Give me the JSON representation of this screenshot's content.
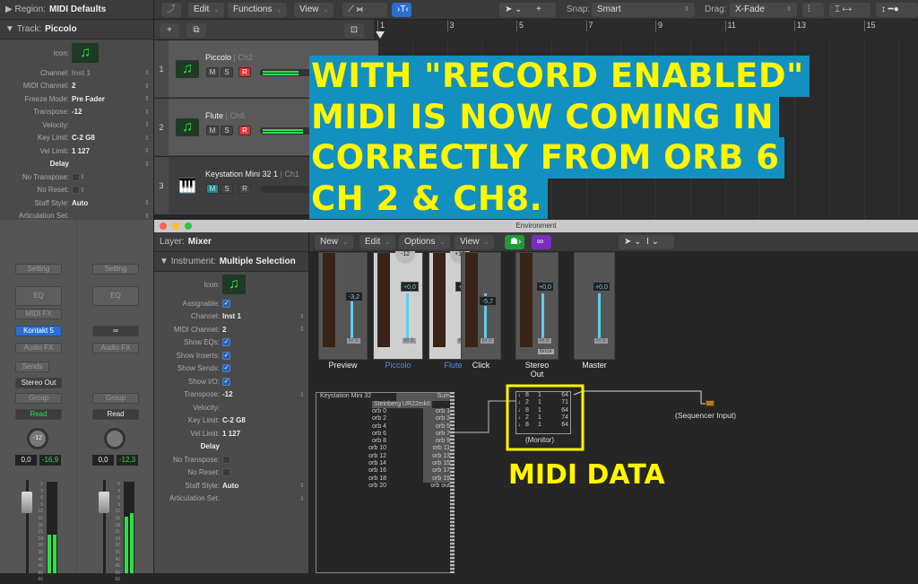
{
  "inspector": {
    "region_label": "Region:",
    "region_value": "MIDI Defaults",
    "track_label": "Track:",
    "track_value": "Piccolo",
    "icon_label": "Icon:",
    "params": [
      {
        "label": "Channel:",
        "value": "Inst 1",
        "dim": true
      },
      {
        "label": "MIDI Channel:",
        "value": "2"
      },
      {
        "label": "Freeze Mode:",
        "value": "Pre Fader"
      },
      {
        "label": "Transpose:",
        "value": "-12"
      },
      {
        "label": "Velocity:",
        "value": ""
      },
      {
        "label": "Key Limit:",
        "value": "C-2  G8"
      },
      {
        "label": "Vel Limit:",
        "value": "1  127"
      },
      {
        "label": "Delay",
        "value": ""
      },
      {
        "label": "No Transpose:",
        "value": ""
      },
      {
        "label": "No Reset:",
        "value": ""
      },
      {
        "label": "Staff Style:",
        "value": "Auto"
      },
      {
        "label": "Articulation Set:",
        "value": ""
      }
    ]
  },
  "strips": [
    {
      "setting": "Setting",
      "eq": "EQ",
      "midi_fx": "MIDI FX",
      "instrument": "Kontakt 5",
      "audio_fx": "Audio FX",
      "sends": "Sends",
      "output": "Stereo Out",
      "group": "Group",
      "automation": "Read",
      "pan": "-12",
      "volume": "0,0",
      "peak": "-16,9",
      "meter_level": 0.42
    },
    {
      "setting": "Setting",
      "eq": "EQ",
      "link": "link",
      "audio_fx": "Audio FX",
      "group": "Group",
      "automation": "Read",
      "pan": "",
      "volume": "0,0",
      "peak": "-12,3",
      "meter_level": 0.62
    }
  ],
  "meter_scale": [
    "0",
    "3",
    "6",
    "9",
    "12",
    "15",
    "18",
    "21",
    "24",
    "30",
    "35",
    "40",
    "45",
    "50",
    "60"
  ],
  "toolbar": {
    "edit": "Edit",
    "functions": "Functions",
    "view": "View",
    "snap_label": "Snap:",
    "snap_value": "Smart",
    "drag_label": "Drag:",
    "drag_value": "X-Fade"
  },
  "ruler": [
    "1",
    "3",
    "5",
    "7",
    "9",
    "11",
    "13",
    "15"
  ],
  "tracks": [
    {
      "num": "1",
      "name": "Piccolo",
      "channel": "Ch2",
      "record": true,
      "icon": "music-note",
      "level": 0.8
    },
    {
      "num": "2",
      "name": "Flute",
      "channel": "Ch8",
      "record": true,
      "icon": "music-note",
      "level": 0.9
    },
    {
      "num": "3",
      "name": "Keystation Mini 32 1",
      "channel": "Ch1",
      "record": false,
      "mute": true,
      "icon": "piano",
      "level": 0
    }
  ],
  "track_buttons": {
    "mute": "M",
    "solo": "S",
    "record": "R"
  },
  "environment": {
    "title": "Environment",
    "layer_label": "Layer:",
    "layer_value": "Mixer",
    "instrument_label": "Instrument:",
    "instrument_value": "Multiple Selection",
    "params": [
      {
        "label": "Icon:",
        "type": "icon"
      },
      {
        "label": "Assignable:",
        "type": "check",
        "on": true
      },
      {
        "label": "Channel:",
        "value": "Inst 1",
        "arrow": true
      },
      {
        "label": "MIDI Channel:",
        "value": "2",
        "arrow": true
      },
      {
        "label": "Show EQs:",
        "type": "check",
        "on": true
      },
      {
        "label": "Show Inserts:",
        "type": "check",
        "on": true
      },
      {
        "label": "Show Sends:",
        "type": "check",
        "on": true
      },
      {
        "label": "Show I/O:",
        "type": "check",
        "on": true
      },
      {
        "label": "Transpose:",
        "value": "-12",
        "arrow": true
      },
      {
        "label": "Velocity:",
        "value": ""
      },
      {
        "label": "Key Limit:",
        "value": "C-2  G8"
      },
      {
        "label": "Vel Limit:",
        "value": "1  127"
      },
      {
        "label": "Delay",
        "value": ""
      },
      {
        "label": "No Transpose:",
        "type": "check",
        "on": false
      },
      {
        "label": "No Reset:",
        "type": "check",
        "on": false
      },
      {
        "label": "Staff Style:",
        "value": "Auto",
        "arrow": true
      },
      {
        "label": "Articulation Set:",
        "value": "",
        "arrow": true
      }
    ],
    "menu": {
      "new": "New",
      "edit": "Edit",
      "options": "Options",
      "view": "View"
    },
    "mixer_channels": [
      {
        "name": "Preview",
        "value": "-3,2",
        "highlight": false
      },
      {
        "name": "Piccolo",
        "value": "+0,0",
        "pan": "-12",
        "highlight": true
      },
      {
        "name": "Flute",
        "value": "+0,0",
        "pan": "+12",
        "highlight": true
      },
      {
        "name": "Click",
        "value": "-5,7",
        "highlight": false
      },
      {
        "name": "Stereo Out",
        "value": "+0,0",
        "bnce": "Bnce",
        "highlight": false
      },
      {
        "name": "Master",
        "value": "+0,0",
        "highlight": false
      }
    ],
    "physical_input": {
      "title": "Keystation Mini 32",
      "device": "Steinberg UR22mkII",
      "sum": "Sum",
      "left_ports": [
        "orb 0",
        "orb 2",
        "orb 4",
        "orb 6",
        "orb 8",
        "orb 10",
        "orb 12",
        "orb 14",
        "orb 16",
        "orb 18",
        "orb 20"
      ],
      "right_ports": [
        "orb 1",
        "orb 3",
        "orb 5",
        "orb 7",
        "orb 9",
        "orb 11",
        "orb 13",
        "orb 15",
        "orb 17",
        "orb 19",
        "orb out"
      ]
    },
    "monitor": {
      "label": "(Monitor)",
      "rows": [
        [
          "8",
          "1",
          "64"
        ],
        [
          "2",
          "1",
          "71"
        ],
        [
          "8",
          "1",
          "64"
        ],
        [
          "2",
          "1",
          "74"
        ],
        [
          "8",
          "1",
          "64"
        ]
      ]
    },
    "sequencer_input": "(Sequencer Input)"
  },
  "annotations": {
    "banner_lines": [
      "WITH \"RECORD ENABLED\"",
      "MIDI IS NOW COMING IN",
      "CORRECTLY FROM ORB 6",
      "CH 2 & CH8."
    ],
    "midi_data": "MIDI DATA",
    "highlight_color": "#fff600",
    "banner_bg": "#1290c0"
  }
}
